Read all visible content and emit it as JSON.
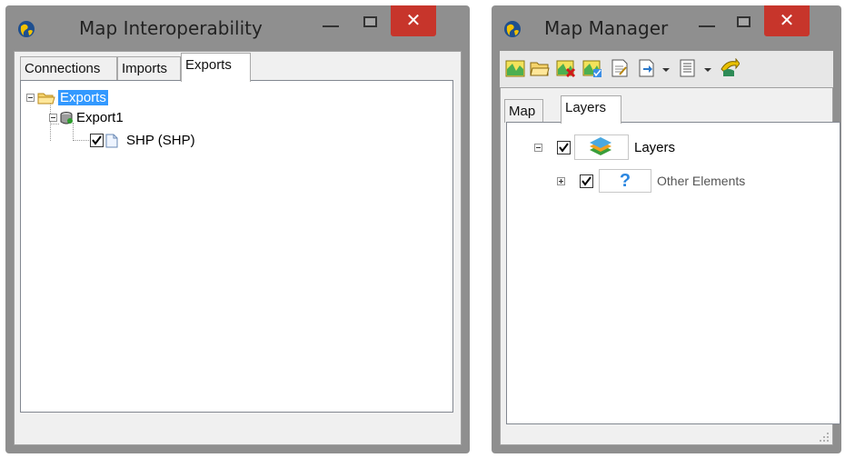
{
  "window1": {
    "title": "Map Interoperability",
    "tabs": [
      {
        "label": "Connections",
        "selected": false
      },
      {
        "label": "Imports",
        "selected": false
      },
      {
        "label": "Exports",
        "selected": true
      }
    ],
    "tree": {
      "root": {
        "label": "Exports",
        "icon": "folder-icon",
        "expanded": true,
        "selected": true
      },
      "child": {
        "label": "Export1",
        "icon": "database-icon",
        "expanded": true
      },
      "leaf": {
        "label": "SHP (SHP)",
        "icon": "document-icon",
        "checked": true
      }
    }
  },
  "window2": {
    "title": "Map Manager",
    "toolbar": [
      {
        "icon": "open-map-icon"
      },
      {
        "icon": "open-folder-icon"
      },
      {
        "icon": "remove-map-icon"
      },
      {
        "icon": "check-map-icon"
      },
      {
        "icon": "properties-icon"
      },
      {
        "icon": "export-icon",
        "dropdown": true
      },
      {
        "icon": "list-icon",
        "dropdown": true
      },
      {
        "icon": "go-icon"
      }
    ],
    "tabs": [
      {
        "label": "Map",
        "selected": false
      },
      {
        "label": "Layers",
        "selected": true
      }
    ],
    "layers": [
      {
        "label": "Layers",
        "icon": "layers-icon",
        "checked": true,
        "expanded": true
      },
      {
        "label": "Other Elements",
        "icon": "question-icon",
        "checked": true,
        "expanded": false
      }
    ]
  },
  "colors": {
    "frame": "#8f8f8f",
    "close_button": "#c7352b",
    "selection": "#3399ff"
  }
}
